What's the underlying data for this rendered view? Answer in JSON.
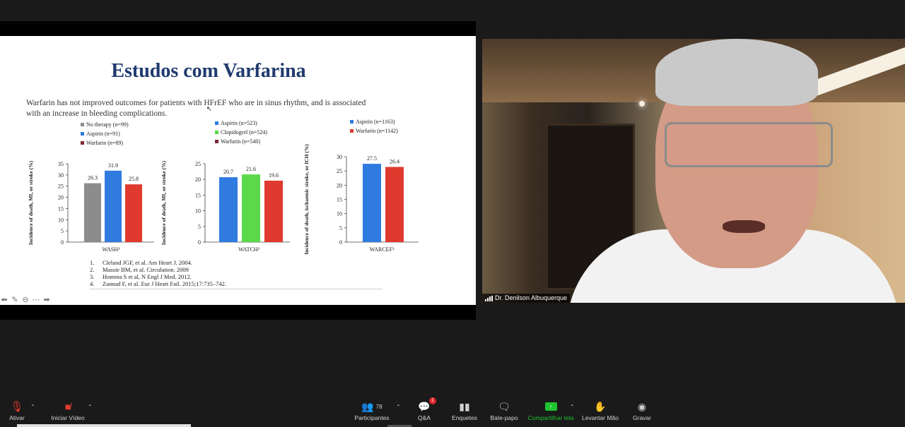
{
  "slide": {
    "title": "Estudos com Varfarina",
    "body": "Warfarin has not improved outcomes for patients with HFrEF who are in sinus rhythm, and is associated with an increase in bleeding complications.",
    "references": [
      {
        "n": "1.",
        "text": "Cleland JGF, et al. Am Heart J. 2004."
      },
      {
        "n": "2.",
        "text": "Massie BM, et al. Circulation. 2009"
      },
      {
        "n": "3.",
        "text": "Homma S et al, N Engl J Med. 2012."
      },
      {
        "n": "4.",
        "text": "Zannad F, et al. Eur J Heart Fail. 2015;17:735–742."
      }
    ]
  },
  "chart_data": [
    {
      "type": "bar",
      "xlabel": "WASH¹",
      "ylabel": "Incidence of death, MI, or stroke (%)",
      "ylim": [
        0,
        35
      ],
      "yticks": [
        0,
        5,
        10,
        15,
        20,
        25,
        30,
        35
      ],
      "categories": [
        "No therapy (n=99)",
        "Aspirin (n=91)",
        "Warfarin (n=89)"
      ],
      "values": [
        26.3,
        31.9,
        25.8
      ],
      "colors": [
        "#8c8c8c",
        "#2f7be0",
        "#e03a2e"
      ],
      "legend_colors": [
        "#8c8c8c",
        "#2f7be0",
        "#7a2a35"
      ]
    },
    {
      "type": "bar",
      "xlabel": "WATCH²",
      "ylabel": "Incidence of death, MI, or stroke (%)",
      "ylim": [
        0,
        25
      ],
      "yticks": [
        0,
        5,
        10,
        15,
        20,
        25
      ],
      "categories": [
        "Aspirin (n=523)",
        "Clopidogrel (n=524)",
        "Warfarin (n=540)"
      ],
      "values": [
        20.7,
        21.6,
        19.6
      ],
      "colors": [
        "#2f7be0",
        "#5bd94a",
        "#e03a2e"
      ],
      "legend_colors": [
        "#2f7be0",
        "#5bd94a",
        "#7a2a35"
      ]
    },
    {
      "type": "bar",
      "xlabel": "WARCEF³",
      "ylabel": "Incidence of death, ischaemic stroke, or ICH (%)",
      "ylim": [
        0,
        30
      ],
      "yticks": [
        0,
        5,
        10,
        15,
        20,
        25,
        30
      ],
      "categories": [
        "Aspirin (n=1163)",
        "Warfarin (n=1142)"
      ],
      "values": [
        27.5,
        26.4
      ],
      "colors": [
        "#2f7be0",
        "#e03a2e"
      ],
      "legend_colors": [
        "#2f7be0",
        "#e03a2e"
      ]
    }
  ],
  "video": {
    "participant_name": "Dr. Denilson Albuquerque"
  },
  "toolbar": {
    "mute_label": "Ativar",
    "video_label": "Iniciar Vídeo",
    "participants_label": "Participantes",
    "participants_count": "78",
    "qa_label": "Q&A",
    "qa_badge": "1",
    "polls_label": "Enquetes",
    "chat_label": "Bate-papo",
    "share_label": "Compartilhar tela",
    "raise_hand_label": "Levantar Mão",
    "record_label": "Gravar",
    "share_color": "#1ec32f"
  }
}
